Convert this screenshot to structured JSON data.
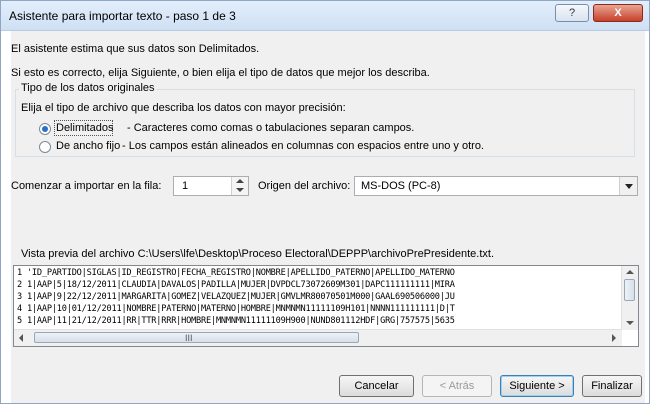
{
  "window": {
    "title": "Asistente para importar texto - paso 1 de 3",
    "help_label": "?",
    "close_label": "X"
  },
  "intro": {
    "line1": "El asistente estima que sus datos son Delimitados.",
    "line2": "Si esto es correcto, elija Siguiente, o bien elija el tipo de datos que mejor los describa."
  },
  "original_type": {
    "group_label": "Tipo de los datos originales",
    "prompt": "Elija el tipo de archivo que describa los datos con mayor precisión:",
    "options": [
      {
        "label": "Delimitados",
        "description": "- Caracteres como comas o tabulaciones separan campos.",
        "selected": true
      },
      {
        "label": "De ancho fijo",
        "description": "- Los campos están alineados en columnas con espacios entre uno y otro.",
        "selected": false
      }
    ]
  },
  "start_row": {
    "label": "Comenzar a importar en la fila:",
    "value": "1"
  },
  "file_origin": {
    "label": "Origen del archivo:",
    "value": "MS-DOS (PC-8)"
  },
  "preview": {
    "label": "Vista previa del archivo C:\\Users\\lfe\\Desktop\\Proceso Electoral\\DEPPP\\archivoPrePresidente.txt.",
    "lines": [
      "1 'ID_PARTIDO|SIGLAS|ID_REGISTRO|FECHA_REGISTRO|NOMBRE|APELLIDO_PATERNO|APELLIDO_MATERNO",
      "2 1|AAP|5|18/12/2011|CLAUDIA|DAVALOS|PADILLA|MUJER|DVPDCL73072609M301|DAPC111111111|MIRA",
      "3 1|AAP|9|22/12/2011|MARGARITA|GOMEZ|VELAZQUEZ|MUJER|GMVLMR80070501M000|GAAL690506000|JU",
      "4 1|AAP|10|01/12/2011|NOMBRE|PATERNO|MATERNO|HOMBRE|MNMNMN11111109H101|NNNN111111111|D|T",
      "5 1|AAP|11|21/12/2011|RR|TTR|RRR|HOMBRE|MNMNMN11111109H900|NUND801112HDF|GRG|757575|5635"
    ],
    "hscroll_grip": "III"
  },
  "buttons": {
    "cancel": "Cancelar",
    "back": "< Atrás",
    "next": "Siguiente >",
    "finish": "Finalizar"
  }
}
